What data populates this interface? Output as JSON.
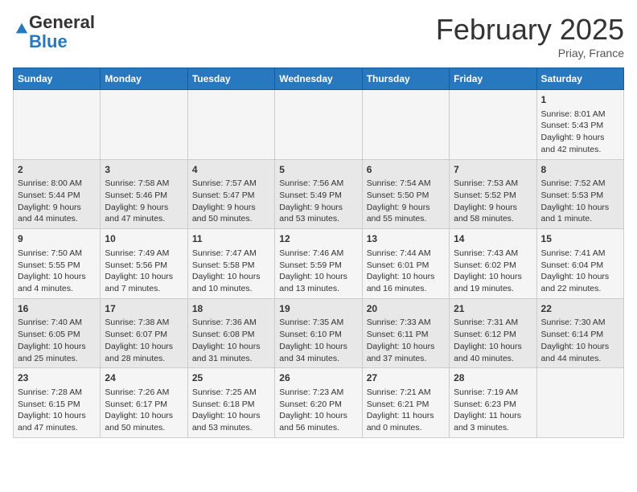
{
  "logo": {
    "general": "General",
    "blue": "Blue"
  },
  "title": {
    "month": "February 2025",
    "location": "Priay, France"
  },
  "calendar": {
    "headers": [
      "Sunday",
      "Monday",
      "Tuesday",
      "Wednesday",
      "Thursday",
      "Friday",
      "Saturday"
    ],
    "weeks": [
      [
        {
          "day": "",
          "info": ""
        },
        {
          "day": "",
          "info": ""
        },
        {
          "day": "",
          "info": ""
        },
        {
          "day": "",
          "info": ""
        },
        {
          "day": "",
          "info": ""
        },
        {
          "day": "",
          "info": ""
        },
        {
          "day": "1",
          "info": "Sunrise: 8:01 AM\nSunset: 5:43 PM\nDaylight: 9 hours and 42 minutes."
        }
      ],
      [
        {
          "day": "2",
          "info": "Sunrise: 8:00 AM\nSunset: 5:44 PM\nDaylight: 9 hours and 44 minutes."
        },
        {
          "day": "3",
          "info": "Sunrise: 7:58 AM\nSunset: 5:46 PM\nDaylight: 9 hours and 47 minutes."
        },
        {
          "day": "4",
          "info": "Sunrise: 7:57 AM\nSunset: 5:47 PM\nDaylight: 9 hours and 50 minutes."
        },
        {
          "day": "5",
          "info": "Sunrise: 7:56 AM\nSunset: 5:49 PM\nDaylight: 9 hours and 53 minutes."
        },
        {
          "day": "6",
          "info": "Sunrise: 7:54 AM\nSunset: 5:50 PM\nDaylight: 9 hours and 55 minutes."
        },
        {
          "day": "7",
          "info": "Sunrise: 7:53 AM\nSunset: 5:52 PM\nDaylight: 9 hours and 58 minutes."
        },
        {
          "day": "8",
          "info": "Sunrise: 7:52 AM\nSunset: 5:53 PM\nDaylight: 10 hours and 1 minute."
        }
      ],
      [
        {
          "day": "9",
          "info": "Sunrise: 7:50 AM\nSunset: 5:55 PM\nDaylight: 10 hours and 4 minutes."
        },
        {
          "day": "10",
          "info": "Sunrise: 7:49 AM\nSunset: 5:56 PM\nDaylight: 10 hours and 7 minutes."
        },
        {
          "day": "11",
          "info": "Sunrise: 7:47 AM\nSunset: 5:58 PM\nDaylight: 10 hours and 10 minutes."
        },
        {
          "day": "12",
          "info": "Sunrise: 7:46 AM\nSunset: 5:59 PM\nDaylight: 10 hours and 13 minutes."
        },
        {
          "day": "13",
          "info": "Sunrise: 7:44 AM\nSunset: 6:01 PM\nDaylight: 10 hours and 16 minutes."
        },
        {
          "day": "14",
          "info": "Sunrise: 7:43 AM\nSunset: 6:02 PM\nDaylight: 10 hours and 19 minutes."
        },
        {
          "day": "15",
          "info": "Sunrise: 7:41 AM\nSunset: 6:04 PM\nDaylight: 10 hours and 22 minutes."
        }
      ],
      [
        {
          "day": "16",
          "info": "Sunrise: 7:40 AM\nSunset: 6:05 PM\nDaylight: 10 hours and 25 minutes."
        },
        {
          "day": "17",
          "info": "Sunrise: 7:38 AM\nSunset: 6:07 PM\nDaylight: 10 hours and 28 minutes."
        },
        {
          "day": "18",
          "info": "Sunrise: 7:36 AM\nSunset: 6:08 PM\nDaylight: 10 hours and 31 minutes."
        },
        {
          "day": "19",
          "info": "Sunrise: 7:35 AM\nSunset: 6:10 PM\nDaylight: 10 hours and 34 minutes."
        },
        {
          "day": "20",
          "info": "Sunrise: 7:33 AM\nSunset: 6:11 PM\nDaylight: 10 hours and 37 minutes."
        },
        {
          "day": "21",
          "info": "Sunrise: 7:31 AM\nSunset: 6:12 PM\nDaylight: 10 hours and 40 minutes."
        },
        {
          "day": "22",
          "info": "Sunrise: 7:30 AM\nSunset: 6:14 PM\nDaylight: 10 hours and 44 minutes."
        }
      ],
      [
        {
          "day": "23",
          "info": "Sunrise: 7:28 AM\nSunset: 6:15 PM\nDaylight: 10 hours and 47 minutes."
        },
        {
          "day": "24",
          "info": "Sunrise: 7:26 AM\nSunset: 6:17 PM\nDaylight: 10 hours and 50 minutes."
        },
        {
          "day": "25",
          "info": "Sunrise: 7:25 AM\nSunset: 6:18 PM\nDaylight: 10 hours and 53 minutes."
        },
        {
          "day": "26",
          "info": "Sunrise: 7:23 AM\nSunset: 6:20 PM\nDaylight: 10 hours and 56 minutes."
        },
        {
          "day": "27",
          "info": "Sunrise: 7:21 AM\nSunset: 6:21 PM\nDaylight: 11 hours and 0 minutes."
        },
        {
          "day": "28",
          "info": "Sunrise: 7:19 AM\nSunset: 6:23 PM\nDaylight: 11 hours and 3 minutes."
        },
        {
          "day": "",
          "info": ""
        }
      ]
    ]
  }
}
